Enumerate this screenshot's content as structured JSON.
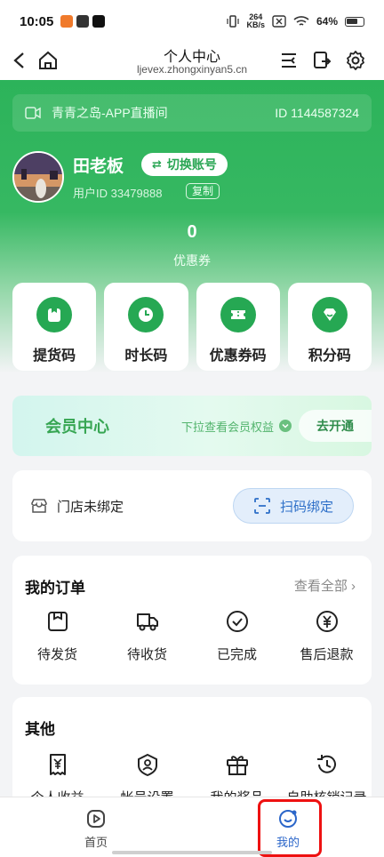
{
  "status_bar": {
    "time": "10:05",
    "net_speed_value": "264",
    "net_speed_unit": "KB/s",
    "battery": "64%"
  },
  "browser": {
    "title": "个人中心",
    "url": "ljevex.zhongxinyan5.cn"
  },
  "header": {
    "live_name": "青青之岛-APP直播间",
    "live_id": "ID 1144587324",
    "username": "田老板",
    "switch_account": "切换账号",
    "user_id": "用户ID 33479888",
    "copy": "复制",
    "coupon_count": "0",
    "coupon_label": "优惠券"
  },
  "codes": [
    {
      "label": "提货码",
      "icon": "bag-icon"
    },
    {
      "label": "时长码",
      "icon": "clock-icon"
    },
    {
      "label": "优惠券码",
      "icon": "ticket-icon"
    },
    {
      "label": "积分码",
      "icon": "points-icon"
    }
  ],
  "member": {
    "title": "会员中心",
    "hint": "下拉查看会员权益",
    "button": "去开通"
  },
  "store": {
    "text": "门店未绑定",
    "scan_button": "扫码绑定"
  },
  "orders": {
    "title": "我的订单",
    "view_all": "查看全部",
    "items": [
      {
        "label": "待发货",
        "icon": "package-icon"
      },
      {
        "label": "待收货",
        "icon": "truck-icon"
      },
      {
        "label": "已完成",
        "icon": "check-circle-icon"
      },
      {
        "label": "售后退款",
        "icon": "yen-circle-icon"
      }
    ]
  },
  "other": {
    "title": "其他",
    "items": [
      {
        "label": "个人收益",
        "icon": "yen-ticket-icon"
      },
      {
        "label": "帐号设置",
        "icon": "user-shield-icon"
      },
      {
        "label": "我的奖品",
        "icon": "gift-icon"
      },
      {
        "label": "自助核销记录",
        "icon": "history-icon"
      }
    ]
  },
  "bottom_nav": {
    "home": "首页",
    "mine": "我的"
  },
  "colors": {
    "brand_green": "#2cb35a",
    "accent_blue": "#2b66c9",
    "highlight_red": "#e11111"
  }
}
